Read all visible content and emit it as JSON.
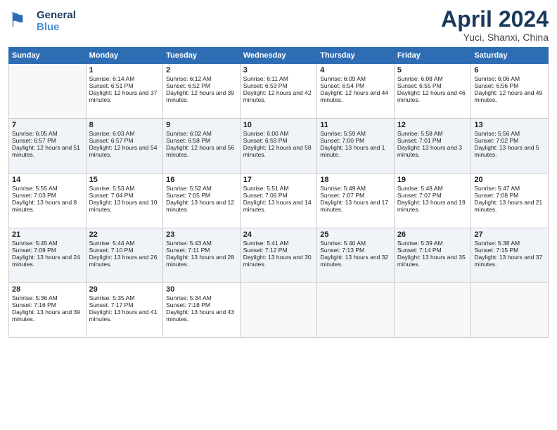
{
  "header": {
    "logo_line1": "General",
    "logo_line2": "Blue",
    "title": "April 2024",
    "subtitle": "Yuci, Shanxi, China"
  },
  "weekdays": [
    "Sunday",
    "Monday",
    "Tuesday",
    "Wednesday",
    "Thursday",
    "Friday",
    "Saturday"
  ],
  "weeks": [
    [
      {
        "day": null
      },
      {
        "day": 1,
        "sunrise": "6:14 AM",
        "sunset": "6:51 PM",
        "daylight": "12 hours and 37 minutes."
      },
      {
        "day": 2,
        "sunrise": "6:12 AM",
        "sunset": "6:52 PM",
        "daylight": "12 hours and 39 minutes."
      },
      {
        "day": 3,
        "sunrise": "6:11 AM",
        "sunset": "6:53 PM",
        "daylight": "12 hours and 42 minutes."
      },
      {
        "day": 4,
        "sunrise": "6:09 AM",
        "sunset": "6:54 PM",
        "daylight": "12 hours and 44 minutes."
      },
      {
        "day": 5,
        "sunrise": "6:08 AM",
        "sunset": "6:55 PM",
        "daylight": "12 hours and 46 minutes."
      },
      {
        "day": 6,
        "sunrise": "6:06 AM",
        "sunset": "6:56 PM",
        "daylight": "12 hours and 49 minutes."
      }
    ],
    [
      {
        "day": 7,
        "sunrise": "6:05 AM",
        "sunset": "6:57 PM",
        "daylight": "12 hours and 51 minutes."
      },
      {
        "day": 8,
        "sunrise": "6:03 AM",
        "sunset": "6:57 PM",
        "daylight": "12 hours and 54 minutes."
      },
      {
        "day": 9,
        "sunrise": "6:02 AM",
        "sunset": "6:58 PM",
        "daylight": "12 hours and 56 minutes."
      },
      {
        "day": 10,
        "sunrise": "6:00 AM",
        "sunset": "6:59 PM",
        "daylight": "12 hours and 58 minutes."
      },
      {
        "day": 11,
        "sunrise": "5:59 AM",
        "sunset": "7:00 PM",
        "daylight": "13 hours and 1 minute."
      },
      {
        "day": 12,
        "sunrise": "5:58 AM",
        "sunset": "7:01 PM",
        "daylight": "13 hours and 3 minutes."
      },
      {
        "day": 13,
        "sunrise": "5:56 AM",
        "sunset": "7:02 PM",
        "daylight": "13 hours and 5 minutes."
      }
    ],
    [
      {
        "day": 14,
        "sunrise": "5:55 AM",
        "sunset": "7:03 PM",
        "daylight": "13 hours and 8 minutes."
      },
      {
        "day": 15,
        "sunrise": "5:53 AM",
        "sunset": "7:04 PM",
        "daylight": "13 hours and 10 minutes."
      },
      {
        "day": 16,
        "sunrise": "5:52 AM",
        "sunset": "7:05 PM",
        "daylight": "13 hours and 12 minutes."
      },
      {
        "day": 17,
        "sunrise": "5:51 AM",
        "sunset": "7:06 PM",
        "daylight": "13 hours and 14 minutes."
      },
      {
        "day": 18,
        "sunrise": "5:49 AM",
        "sunset": "7:07 PM",
        "daylight": "13 hours and 17 minutes."
      },
      {
        "day": 19,
        "sunrise": "5:48 AM",
        "sunset": "7:07 PM",
        "daylight": "13 hours and 19 minutes."
      },
      {
        "day": 20,
        "sunrise": "5:47 AM",
        "sunset": "7:08 PM",
        "daylight": "13 hours and 21 minutes."
      }
    ],
    [
      {
        "day": 21,
        "sunrise": "5:45 AM",
        "sunset": "7:09 PM",
        "daylight": "13 hours and 24 minutes."
      },
      {
        "day": 22,
        "sunrise": "5:44 AM",
        "sunset": "7:10 PM",
        "daylight": "13 hours and 26 minutes."
      },
      {
        "day": 23,
        "sunrise": "5:43 AM",
        "sunset": "7:11 PM",
        "daylight": "13 hours and 28 minutes."
      },
      {
        "day": 24,
        "sunrise": "5:41 AM",
        "sunset": "7:12 PM",
        "daylight": "13 hours and 30 minutes."
      },
      {
        "day": 25,
        "sunrise": "5:40 AM",
        "sunset": "7:13 PM",
        "daylight": "13 hours and 32 minutes."
      },
      {
        "day": 26,
        "sunrise": "5:39 AM",
        "sunset": "7:14 PM",
        "daylight": "13 hours and 35 minutes."
      },
      {
        "day": 27,
        "sunrise": "5:38 AM",
        "sunset": "7:15 PM",
        "daylight": "13 hours and 37 minutes."
      }
    ],
    [
      {
        "day": 28,
        "sunrise": "5:36 AM",
        "sunset": "7:16 PM",
        "daylight": "13 hours and 39 minutes."
      },
      {
        "day": 29,
        "sunrise": "5:35 AM",
        "sunset": "7:17 PM",
        "daylight": "13 hours and 41 minutes."
      },
      {
        "day": 30,
        "sunrise": "5:34 AM",
        "sunset": "7:18 PM",
        "daylight": "13 hours and 43 minutes."
      },
      {
        "day": null
      },
      {
        "day": null
      },
      {
        "day": null
      },
      {
        "day": null
      }
    ]
  ],
  "labels": {
    "sunrise": "Sunrise:",
    "sunset": "Sunset:",
    "daylight": "Daylight:"
  }
}
